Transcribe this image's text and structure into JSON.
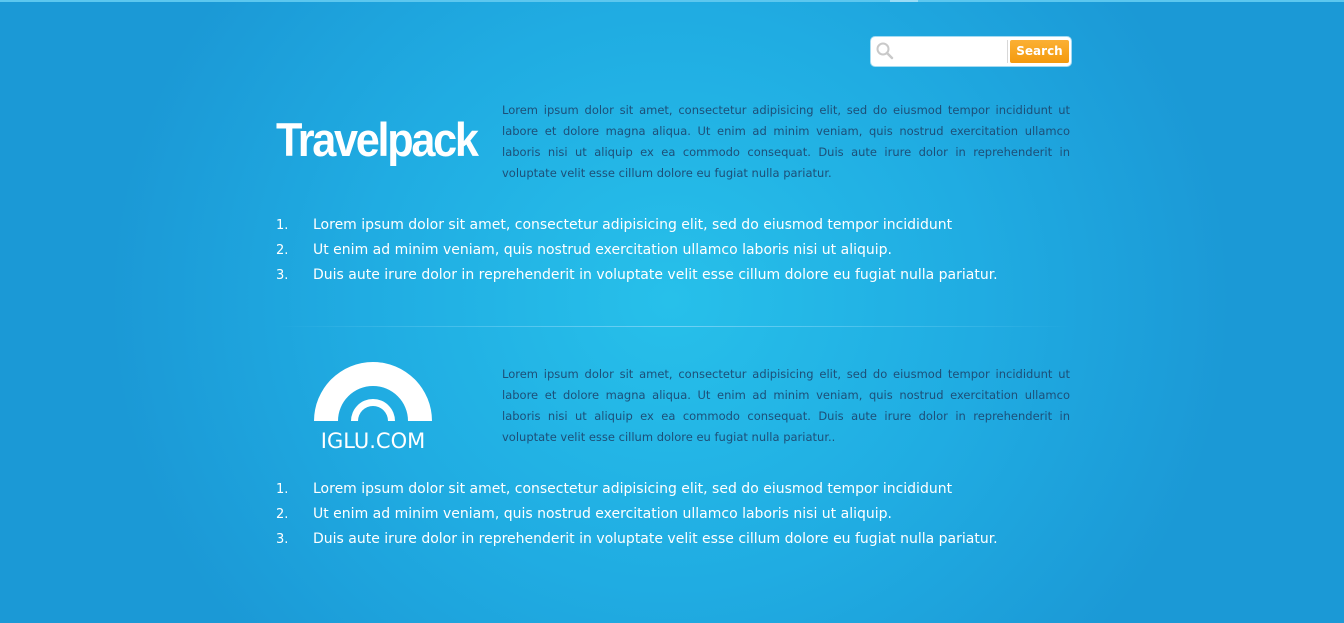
{
  "search": {
    "placeholder": "",
    "value": "",
    "button_label": "Search"
  },
  "partners": [
    {
      "logo_text": "Travelpack",
      "description": "Lorem ipsum dolor sit amet, consectetur adipisicing elit, sed do eiusmod tempor incididunt ut labore et dolore magna aliqua. Ut enim ad minim veniam, quis nostrud exercitation ullamco laboris nisi ut aliquip ex ea commodo consequat. Duis aute irure dolor in reprehenderit in voluptate velit esse cillum dolore eu fugiat nulla pariatur.",
      "list": [
        {
          "num": "1.",
          "text": "Lorem ipsum dolor sit amet, consectetur adipisicing elit, sed do eiusmod tempor incididunt"
        },
        {
          "num": "2.",
          "text": "Ut enim ad minim veniam, quis nostrud exercitation ullamco laboris nisi ut aliquip."
        },
        {
          "num": "3.",
          "text": "Duis aute irure dolor in reprehenderit in voluptate velit esse cillum dolore eu fugiat nulla pariatur."
        }
      ]
    },
    {
      "logo_text": "IGLU.COM",
      "description": "Lorem ipsum dolor sit amet, consectetur adipisicing elit, sed do eiusmod tempor incididunt ut labore et dolore magna aliqua. Ut enim ad minim veniam, quis nostrud exercitation ullamco laboris nisi ut aliquip ex ea commodo consequat. Duis aute irure dolor in reprehenderit in voluptate velit esse cillum dolore eu fugiat nulla pariatur..",
      "list": [
        {
          "num": "1.",
          "text": "Lorem ipsum dolor sit amet, consectetur adipisicing elit, sed do eiusmod tempor incididunt"
        },
        {
          "num": "2.",
          "text": "Ut enim ad minim veniam, quis nostrud exercitation ullamco laboris nisi ut aliquip."
        },
        {
          "num": "3.",
          "text": "Duis aute irure dolor in reprehenderit in voluptate velit esse cillum dolore eu fugiat nulla pariatur."
        }
      ]
    }
  ],
  "colors": {
    "background": "#20ace2",
    "accent_button": "#f7a21b",
    "description_text": "#1d4f78",
    "list_text": "#ffffff"
  },
  "icons": {
    "search": "magnifier-icon"
  }
}
